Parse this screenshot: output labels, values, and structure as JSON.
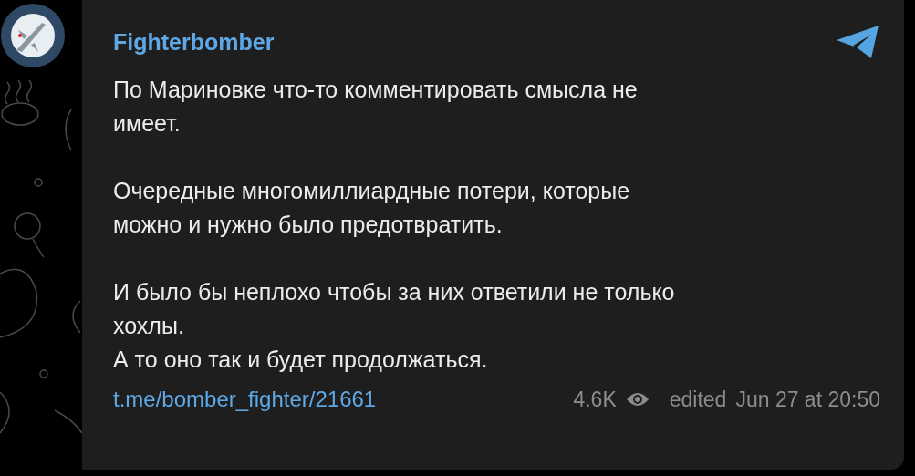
{
  "channel": {
    "name": "Fighterbomber"
  },
  "message": {
    "paragraphs": [
      [
        "По Мариновке что-то комментировать смысла не",
        "имеет."
      ],
      [
        "Очередные многомиллиардные потери, которые",
        "можно и нужно было предотвратить."
      ],
      [
        "И было бы неплохо чтобы за них ответили не только",
        "хохлы.",
        "А то оно так и будет продолжаться."
      ]
    ]
  },
  "footer": {
    "link": "t.me/bomber_fighter/21661",
    "views": "4.6K",
    "edited": "edited",
    "date": "Jun 27 at 20:50"
  }
}
